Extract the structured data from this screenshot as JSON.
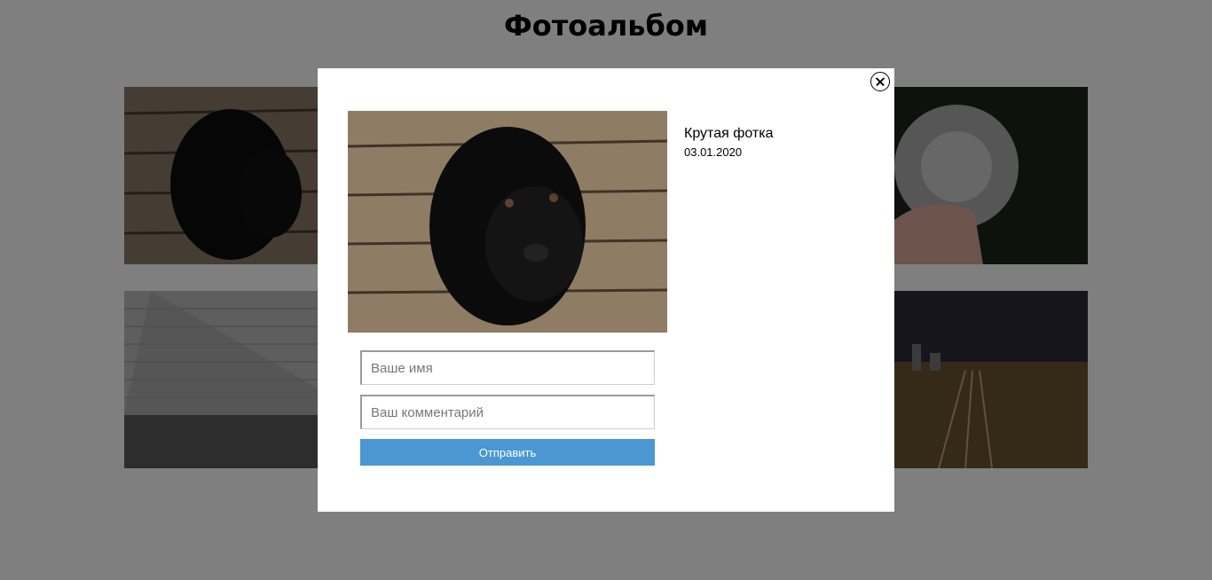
{
  "page": {
    "title": "Фотоальбом"
  },
  "modal": {
    "photo_title": "Крутая фотка",
    "photo_date": "03.01.2020",
    "form": {
      "name_placeholder": "Ваше имя",
      "comment_placeholder": "Ваш комментарий",
      "submit_label": "Отправить"
    }
  },
  "colors": {
    "overlay": "#808080",
    "submit_button": "#4a97d2",
    "modal_background": "#ffffff"
  },
  "gallery": {
    "thumbnails": [
      "puppy-photo",
      "dandelion-photo",
      "stairs-photo",
      "railway-night-photo"
    ]
  }
}
